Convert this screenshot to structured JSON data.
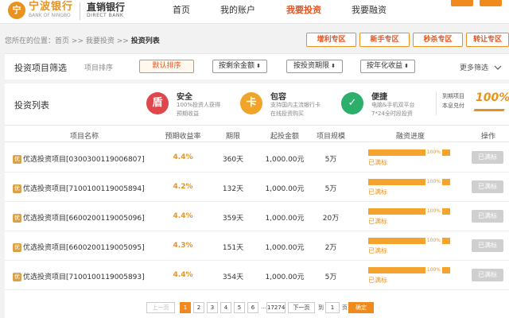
{
  "header": {
    "logo_cn": "宁波银行",
    "logo_en": "BANK OF NINGBO",
    "logo_mark": "宁",
    "brand_cn": "直销银行",
    "brand_en": "DIRECT BANK",
    "nav": [
      "首页",
      "我的账户",
      "我要投资",
      "我要融资"
    ],
    "active_nav": "我要投资"
  },
  "breadcrumb": {
    "prefix": "您所在的位置：",
    "items": [
      "首页",
      "我要投资"
    ],
    "sep": ">>",
    "current": "投资列表"
  },
  "zones": [
    "增利专区",
    "新手专区",
    "秒杀专区",
    "转让专区"
  ],
  "filter": {
    "title": "投资项目筛选",
    "sort_label": "项目排序",
    "sorts": [
      "默认排序",
      "按剩余金额",
      "按投资期限",
      "按年化收益"
    ],
    "sort_arrow": "⬍",
    "more": "更多筛选"
  },
  "list": {
    "title": "投资列表",
    "features": [
      {
        "icon": "盾",
        "title": "安全",
        "desc": [
          "100%投资人获得",
          "预期收益"
        ],
        "color": "#e0474c"
      },
      {
        "icon": "卡",
        "title": "包容",
        "desc": [
          "支持国内主流银行卡",
          "在线投资购买"
        ],
        "color": "#f0a52a"
      },
      {
        "icon": "✓",
        "title": "便捷",
        "desc": [
          "电脑&手机双平台",
          "7*24全时段投资"
        ],
        "color": "#2dae6b"
      }
    ],
    "guarantee": {
      "line1": "到期项目",
      "line2": "本息兑付",
      "badge": "100%"
    }
  },
  "table": {
    "headers": [
      "项目名称",
      "预期收益率",
      "期限",
      "起投金额",
      "项目规模",
      "融资进度",
      "操作"
    ],
    "tag": "优",
    "rows": [
      {
        "name": "优选投资项目[0300300119006807]",
        "rate": "4.4%",
        "term": "360天",
        "min": "1,000.00元",
        "scale": "5万",
        "progress": "100%",
        "status": "已满标",
        "action": "已满标"
      },
      {
        "name": "优选投资项目[7100100119005894]",
        "rate": "4.2%",
        "term": "132天",
        "min": "1,000.00元",
        "scale": "5万",
        "progress": "100%",
        "status": "已满标",
        "action": "已满标"
      },
      {
        "name": "优选投资项目[6600200119005096]",
        "rate": "4.4%",
        "term": "359天",
        "min": "1,000.00元",
        "scale": "20万",
        "progress": "100%",
        "status": "已满标",
        "action": "已满标"
      },
      {
        "name": "优选投资项目[6600200119005095]",
        "rate": "4.3%",
        "term": "151天",
        "min": "1,000.00元",
        "scale": "2万",
        "progress": "100%",
        "status": "已满标",
        "action": "已满标"
      },
      {
        "name": "优选投资项目[7100100119005893]",
        "rate": "4.4%",
        "term": "354天",
        "min": "1,000.00元",
        "scale": "5万",
        "progress": "100%",
        "status": "已满标",
        "action": "已满标"
      }
    ]
  },
  "pagination": {
    "prev": "上一页",
    "pages": [
      "1",
      "2",
      "3",
      "4",
      "5",
      "6"
    ],
    "current": "1",
    "ellipsis": "...",
    "last": "17274",
    "next": "下一页",
    "goto_prefix": "到",
    "goto_value": "1",
    "goto_suffix": "页",
    "confirm": "确定"
  },
  "colors": {
    "accent": "#e8931f",
    "active": "#e8541f",
    "button": "#f08a1e"
  }
}
